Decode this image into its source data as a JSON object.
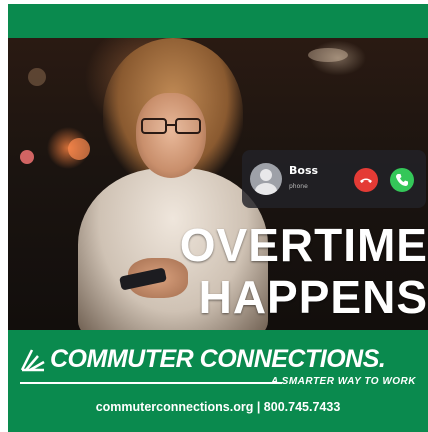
{
  "call": {
    "caller_name": "Boss",
    "caller_subtitle": "phone",
    "decline_icon": "phone-decline-icon",
    "accept_icon": "phone-accept-icon"
  },
  "headline": {
    "line1": "OVERTIME",
    "line2": "HAPPENS"
  },
  "brand": {
    "name": "COMMUTER CONNECTIONS.",
    "tagline": "A SMARTER WAY TO WORK",
    "contact": "commuterconnections.org | 800.745.7433",
    "logo_icon": "commuter-connections-logo-icon"
  },
  "colors": {
    "brand_green": "#0a8a4e",
    "decline_red": "#e43b35",
    "accept_green": "#34c759"
  }
}
